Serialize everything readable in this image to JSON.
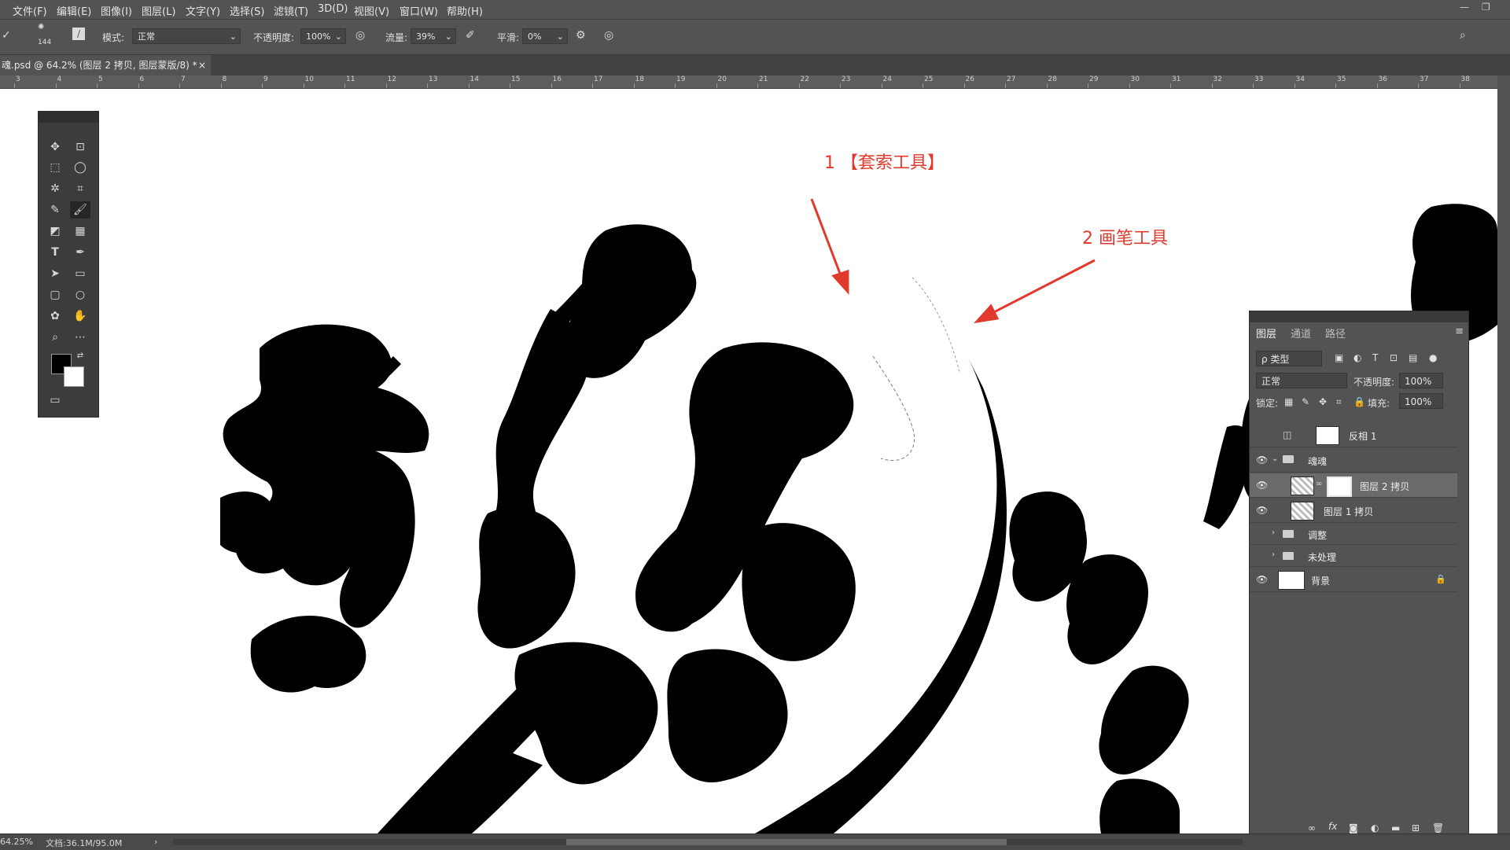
{
  "menu": [
    "文件(F)",
    "编辑(E)",
    "图像(I)",
    "图层(L)",
    "文字(Y)",
    "选择(S)",
    "滤镜(T)",
    "3D(D)",
    "视图(V)",
    "窗口(W)",
    "帮助(H)"
  ],
  "options": {
    "brush_size": "144",
    "mode_label": "模式:",
    "mode_value": "正常",
    "opacity_label": "不透明度:",
    "opacity_value": "100%",
    "flow_label": "流量:",
    "flow_value": "39%",
    "smooth_label": "平滑:",
    "smooth_value": "0%"
  },
  "document_tab": {
    "title": "魂.psd @ 64.2% (图层 2 拷贝, 图层蒙版/8) *",
    "close": "×"
  },
  "ruler_ticks": [
    "3",
    "4",
    "5",
    "6",
    "7",
    "8",
    "9",
    "10",
    "11",
    "12",
    "13",
    "14",
    "15",
    "16",
    "17",
    "18",
    "19",
    "20",
    "21",
    "22",
    "23",
    "24",
    "25",
    "26",
    "27",
    "28",
    "29",
    "30",
    "31",
    "32",
    "33",
    "34",
    "35",
    "36",
    "37",
    "38"
  ],
  "annotations": {
    "lasso": "1 【套索工具】",
    "brush": "2 画笔工具"
  },
  "layers_panel": {
    "tabs": [
      "图层",
      "通道",
      "路径"
    ],
    "filter_label": "ρ 类型",
    "blend_mode": "正常",
    "opacity_label": "不透明度:",
    "opacity_value": "100%",
    "lock_label": "锁定:",
    "fill_label": "填充:",
    "fill_value": "100%",
    "layers": [
      {
        "name": "反相 1",
        "visible": false
      },
      {
        "name": "魂魂",
        "visible": true
      },
      {
        "name": "图层 2 拷贝",
        "visible": true
      },
      {
        "name": "图层 1 拷贝",
        "visible": true
      },
      {
        "name": "调整",
        "visible": false
      },
      {
        "name": "未处理",
        "visible": false
      },
      {
        "name": "背景",
        "visible": true
      }
    ]
  },
  "status": {
    "zoom": "64.25%",
    "doc_size": "文档:36.1M/95.0M"
  },
  "colors": {
    "accent_red": "#e03a2c",
    "ui_gray": "#535353",
    "canvas": "#ffffff"
  }
}
